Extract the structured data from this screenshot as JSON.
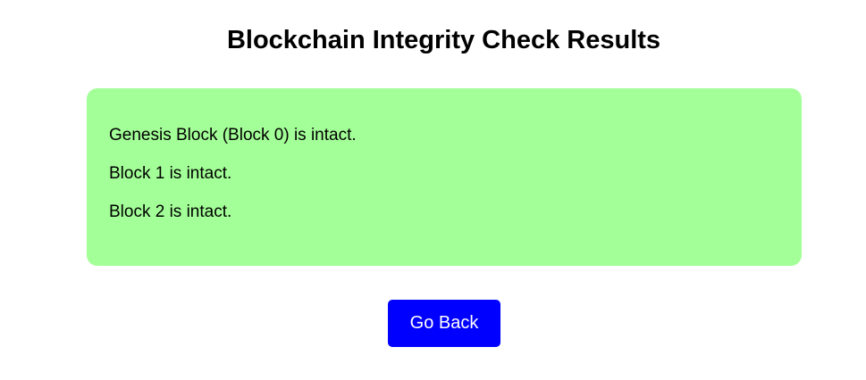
{
  "page": {
    "title": "Blockchain Integrity Check Results"
  },
  "results": {
    "lines": [
      "Genesis Block (Block 0) is intact.",
      "Block 1 is intact.",
      "Block 2 is intact."
    ]
  },
  "actions": {
    "back_label": "Go Back"
  },
  "colors": {
    "panel_background": "#a3ff97",
    "button_background": "#0000ff",
    "button_text": "#ffffff"
  }
}
